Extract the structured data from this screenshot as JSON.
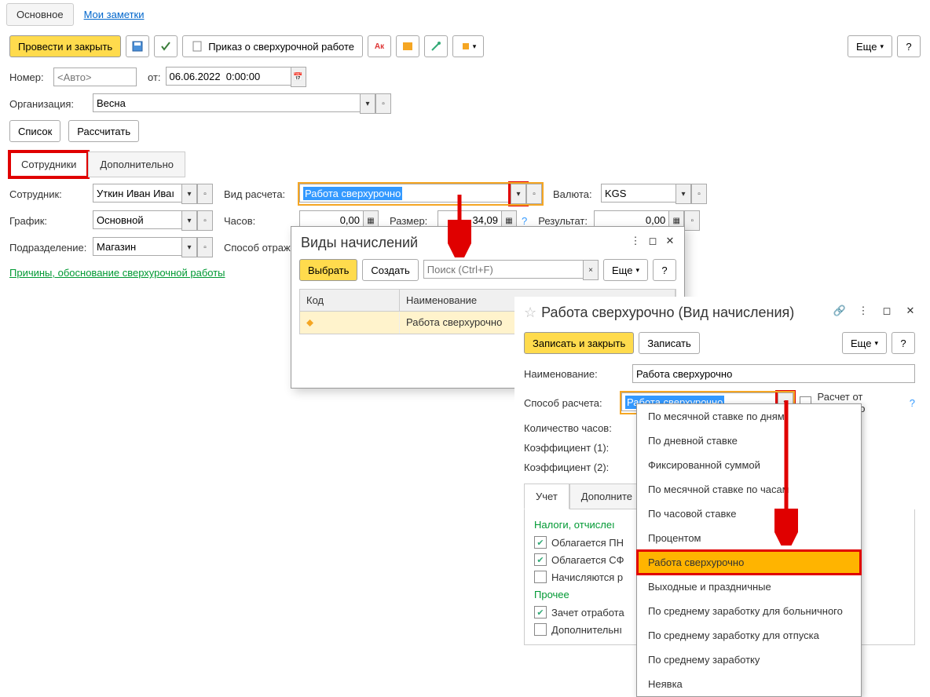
{
  "tabs": {
    "main": "Основное",
    "notes": "Мои заметки"
  },
  "toolbar": {
    "post_close": "Провести и закрыть",
    "order": "Приказ о сверхурочной работе",
    "more": "Еще"
  },
  "form": {
    "number_label": "Номер:",
    "number_placeholder": "<Авто>",
    "from_label": "от:",
    "date_value": "06.06.2022  0:00:00",
    "org_label": "Организация:",
    "org_value": "Весна",
    "list_btn": "Список",
    "calc_btn": "Рассчитать"
  },
  "section_tabs": {
    "employees": "Сотрудники",
    "extra": "Дополнительно"
  },
  "emp": {
    "employee_label": "Сотрудник:",
    "employee_value": "Уткин Иван Иваı",
    "schedule_label": "График:",
    "schedule_value": "Основной",
    "dept_label": "Подразделение:",
    "dept_value": "Магазин",
    "calc_type_label": "Вид расчета:",
    "calc_type_value": "Работа сверхурочно",
    "hours_label": "Часов:",
    "hours_value": "0,00",
    "refl_label": "Способ отраж",
    "size_label": "Размер:",
    "size_value": "34,09",
    "currency_label": "Валюта:",
    "currency_value": "KGS",
    "result_label": "Результат:",
    "result_value": "0,00",
    "reasons_link": "Причины, обоснование сверхурочной работы"
  },
  "popup1": {
    "title": "Виды начислений",
    "select": "Выбрать",
    "create": "Создать",
    "search_placeholder": "Поиск (Ctrl+F)",
    "more": "Еще",
    "col_code": "Код",
    "col_name": "Наименование",
    "row_name": "Работа сверхурочно"
  },
  "popup2": {
    "title": "Работа сверхурочно (Вид начисления)",
    "save_close": "Записать и закрыть",
    "save": "Записать",
    "more": "Еще",
    "name_label": "Наименование:",
    "name_value": "Работа сверхурочно",
    "method_label": "Способ расчета:",
    "method_value": "Работа сверхурочно",
    "reverse_label": "Расчет от обратного",
    "qty_label": "Количество часов:",
    "k1_label": "Коэффициент (1):",
    "k2_label": "Коэффициент (2):",
    "tab_acc": "Учет",
    "tab_extra": "Дополните",
    "sec_tax": "Налоги, отчислеı",
    "chk_pn": "Облагается ПН",
    "chk_sf": "Облагается СФ",
    "chk_accrue": "Начисляются р",
    "sec_other": "Прочее",
    "chk_offset": "Зачет отработа",
    "chk_extra": "Дополнительнı"
  },
  "dropdown": [
    "По месячной ставке по дням",
    "По дневной ставке",
    "Фиксированной суммой",
    "По месячной ставке по часам",
    "По часовой ставке",
    "Процентом",
    "Работа сверхурочно",
    "Выходные и праздничные",
    "По среднему заработку для больничного",
    "По среднему заработку для отпуска",
    "По среднему заработку",
    "Неявка"
  ],
  "dropdown_selected_index": 6
}
